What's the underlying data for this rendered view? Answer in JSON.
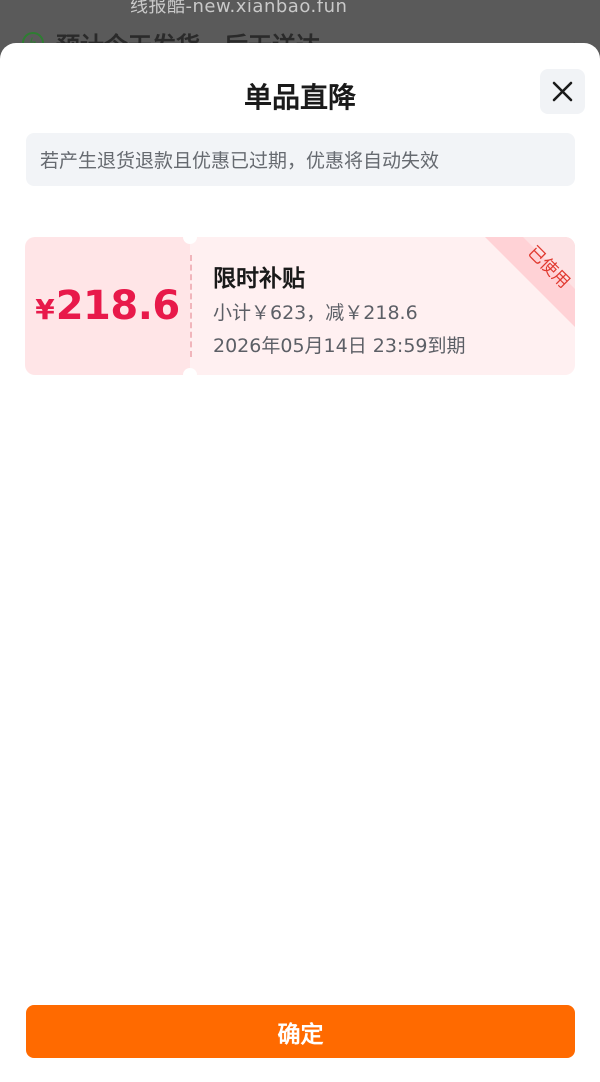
{
  "background": {
    "watermark": "线报酷-new.xianbao.fun",
    "row_text": "预计今天发货，后天送达",
    "bolt_icon": "bolt-circle-icon",
    "chevron_icon": "chevron-right-icon"
  },
  "sheet": {
    "title": "单品直降",
    "close_icon": "close-icon",
    "notice": "若产生退货退款且优惠已过期，优惠将自动失效"
  },
  "coupon": {
    "currency": "¥",
    "amount": "218.6",
    "name": "限时补贴",
    "subtitle": "小计￥623，减￥218.6",
    "expiry": "2026年05月14日 23:59到期",
    "status_stamp": "已使用",
    "colors": {
      "amount": "#e8194a",
      "left_bg": "#ffe5e7",
      "right_bg": "#fff0f1"
    }
  },
  "footer": {
    "confirm_label": "确定",
    "confirm_color": "#ff6a00"
  }
}
